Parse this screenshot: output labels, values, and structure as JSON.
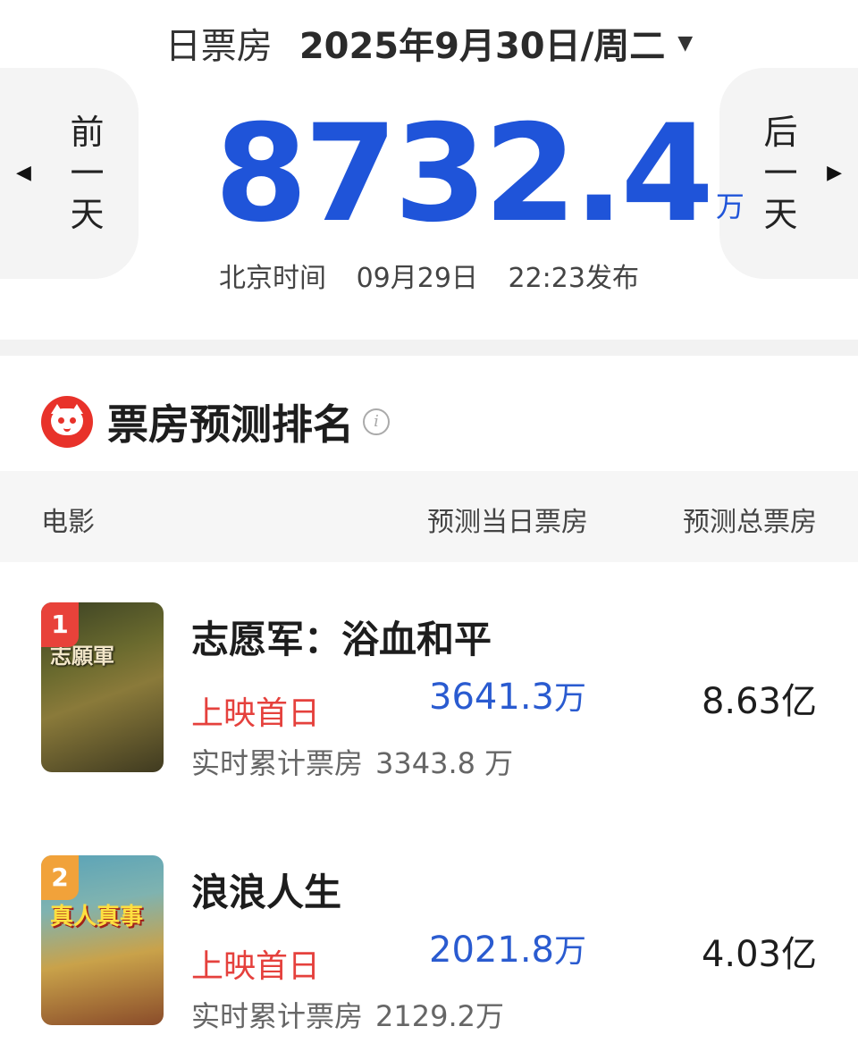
{
  "header": {
    "label": "日票房",
    "date": "2025年9月30日/周二",
    "caret_icon": "caret-down-icon"
  },
  "nav": {
    "prev_label": [
      "前",
      "一",
      "天"
    ],
    "next_label": [
      "后",
      "一",
      "天"
    ]
  },
  "total": {
    "value": "8732.4",
    "unit": "万"
  },
  "publish": {
    "tz": "北京时间",
    "date": "09月29日",
    "time": "22:23发布"
  },
  "ranking": {
    "title": "票房预测排名",
    "columns": [
      "电影",
      "预测当日票房",
      "预测总票房"
    ],
    "movies": [
      {
        "rank": "1",
        "title": "志愿军：浴血和平",
        "release": "上映首日",
        "cum_label": "实时累计票房",
        "cum_value": "3343.8 万",
        "day_value": "3641.3",
        "day_unit": "万",
        "total_value": "8.63",
        "total_unit": "亿",
        "poster_text": "志願軍"
      },
      {
        "rank": "2",
        "title": "浪浪人生",
        "release": "上映首日",
        "cum_label": "实时累计票房",
        "cum_value": "2129.2万",
        "day_value": "2021.8",
        "day_unit": "万",
        "total_value": "4.03",
        "total_unit": "亿",
        "poster_text": "真人真事"
      }
    ]
  },
  "colors": {
    "accent_blue": "#1f54d9",
    "release_red": "#e5413d",
    "logo_red": "#e8322a"
  }
}
